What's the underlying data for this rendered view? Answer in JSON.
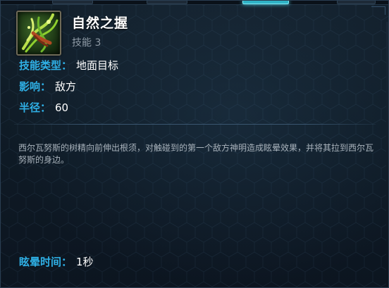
{
  "skill": {
    "name": "自然之握",
    "slot": "技能 3",
    "icon": "tree-roots-icon"
  },
  "stats": [
    {
      "label": "技能类型：",
      "value": "地面目标"
    },
    {
      "label": "影响：",
      "value": "敌方"
    },
    {
      "label": "半径：",
      "value": "60"
    }
  ],
  "description": "西尔瓦努斯的树精向前伸出根须，对触碰到的第一个敌方神明造成眩晕效果，并将其拉到西尔瓦努斯的身边。",
  "stun": {
    "label": "眩晕时间：",
    "value": "1秒"
  },
  "colors": {
    "label": "#2fb0e6",
    "value": "#ffffff",
    "description": "#a9b3bc",
    "active_tab": "#2fb3c6"
  }
}
